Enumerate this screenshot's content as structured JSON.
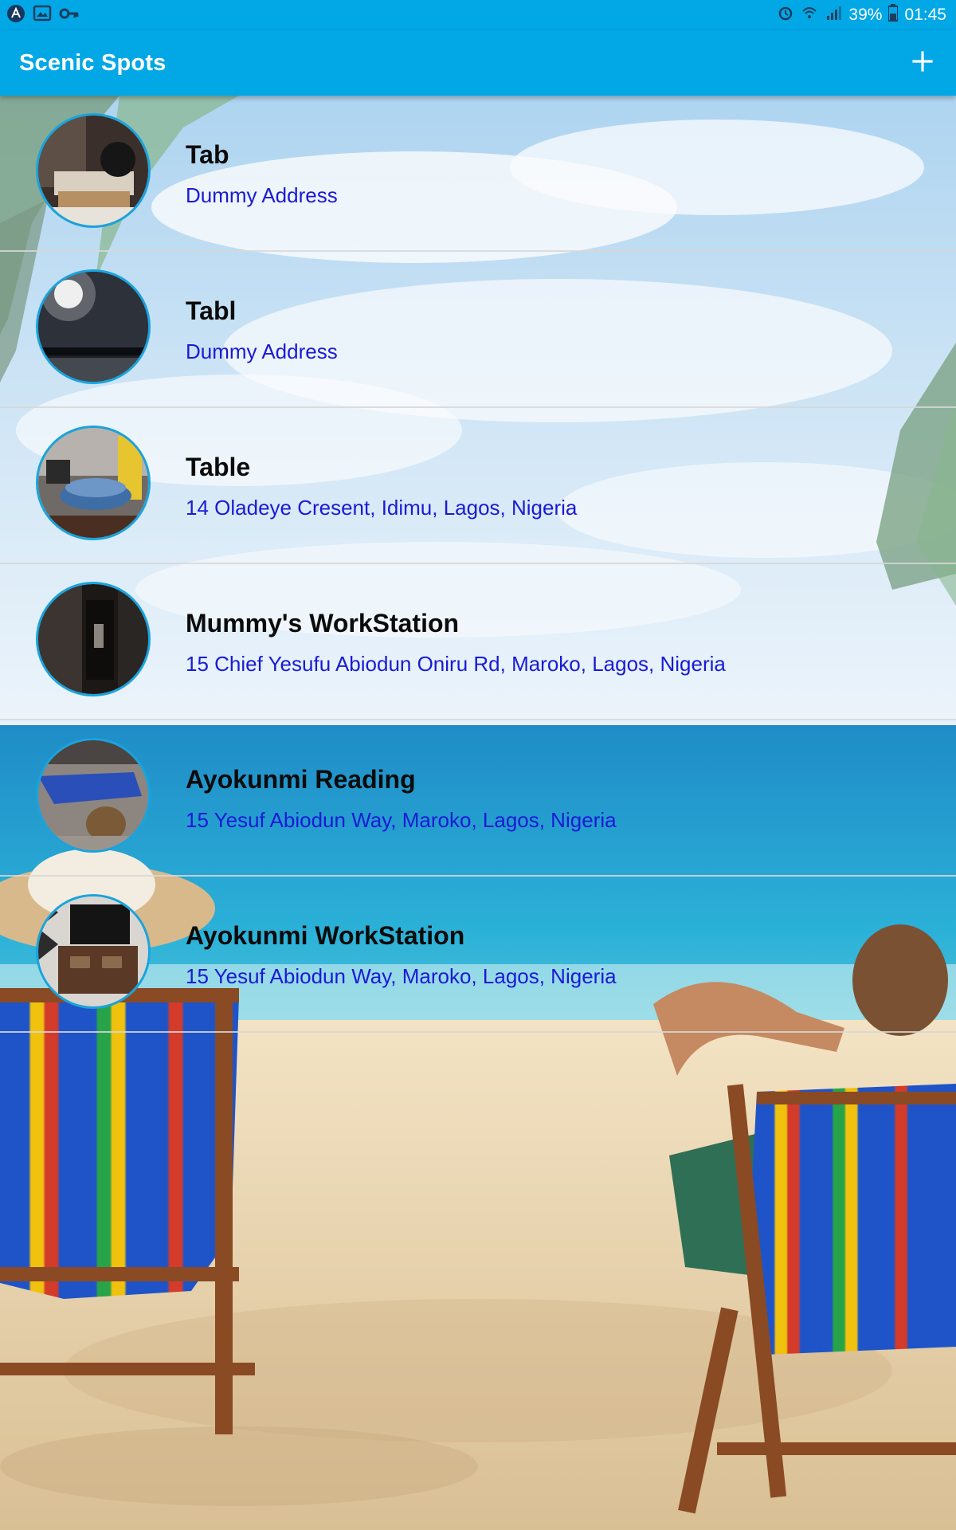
{
  "status_bar": {
    "left_icons": [
      "app-badge-icon",
      "gallery-icon",
      "vpn-key-icon"
    ],
    "right_icons": [
      "alarm-icon",
      "wifi-icon",
      "signal-icon",
      "battery-icon"
    ],
    "battery": "39%",
    "time": "01:45"
  },
  "app_bar": {
    "title": "Scenic Spots",
    "add_icon": "plus-icon"
  },
  "spots": [
    {
      "name": "Tab",
      "address": "Dummy Address"
    },
    {
      "name": "Tabl",
      "address": "Dummy Address"
    },
    {
      "name": "Table",
      "address": "14 Oladeye Cresent, Idimu, Lagos, Nigeria"
    },
    {
      "name": "Mummy's WorkStation",
      "address": "15 Chief Yesufu Abiodun Oniru Rd, Maroko, Lagos, Nigeria"
    },
    {
      "name": "Ayokunmi Reading",
      "address": "15 Yesuf Abiodun Way, Maroko, Lagos, Nigeria"
    },
    {
      "name": "Ayokunmi WorkStation",
      "address": "15 Yesuf Abiodun Way, Maroko, Lagos, Nigeria"
    }
  ],
  "colors": {
    "primary": "#02a7e6",
    "title_text": "#0b0b0b",
    "address_text": "#1a1ad6",
    "avatar_border": "#1aa3dd"
  }
}
